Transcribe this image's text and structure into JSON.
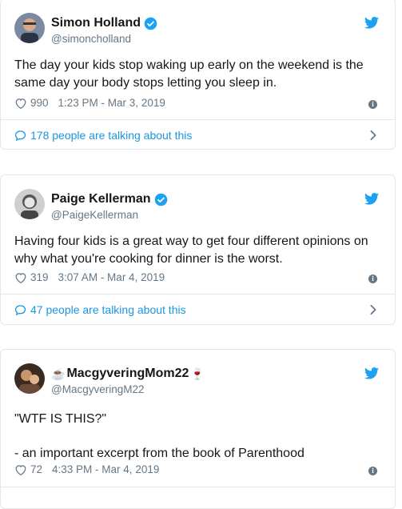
{
  "colors": {
    "accent": "#1da1f2",
    "link": "#1b95e0",
    "muted": "#657786",
    "border": "#e1e8ed"
  },
  "tweets": [
    {
      "name": "Simon Holland",
      "handle": "@simoncholland",
      "name_prefix_emoji": "",
      "name_suffix_emoji": "",
      "text": "The day your kids stop waking up early on the weekend is the same day your body stops letting you sleep in.",
      "likes": "990",
      "timestamp": "1:23 PM - Mar 3, 2019",
      "talking": "178 people are talking about this"
    },
    {
      "name": "Paige Kellerman",
      "handle": "@PaigeKellerman",
      "name_prefix_emoji": "",
      "name_suffix_emoji": "",
      "text": "Having four kids is a great way to get four different opinions on why what you're cooking for dinner is the worst.",
      "likes": "319",
      "timestamp": "3:07 AM - Mar 4, 2019",
      "talking": "47 people are talking about this"
    },
    {
      "name": "MacgyveringMom22",
      "handle": "@MacgyveringM22",
      "name_prefix_emoji": "☕",
      "name_suffix_emoji": "🍷",
      "text": "\"WTF IS THIS?\"\n\n- an important excerpt from the book of Parenthood",
      "likes": "72",
      "timestamp": "4:33 PM - Mar 4, 2019"
    }
  ]
}
